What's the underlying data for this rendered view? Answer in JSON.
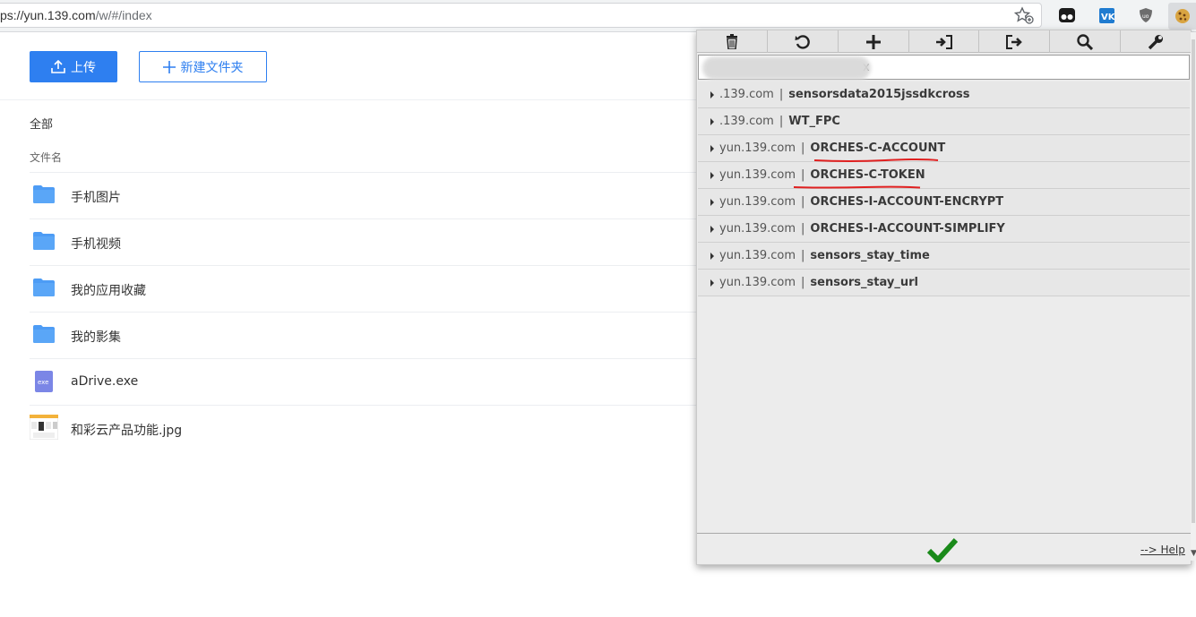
{
  "browser": {
    "url_host": "ps://yun.139.com",
    "url_path": "/w/#/index"
  },
  "toolbar": {
    "upload_label": "上传",
    "new_folder_label": "新建文件夹"
  },
  "breadcrumb": {
    "all": "全部"
  },
  "table": {
    "column_name": "文件名"
  },
  "files": [
    {
      "name": "手机图片",
      "icon": "folder-icon"
    },
    {
      "name": "手机视频",
      "icon": "folder-icon"
    },
    {
      "name": "我的应用收藏",
      "icon": "folder-icon"
    },
    {
      "name": "我的影集",
      "icon": "folder-icon"
    },
    {
      "name": "aDrive.exe",
      "icon": "exe-file-icon",
      "icon_text": "exe"
    },
    {
      "name": "和彩云产品功能.jpg",
      "icon": "image-thumbnail-icon"
    }
  ],
  "cookie_popup": {
    "filter_value": "x",
    "toolbar_icons": [
      "trash-icon",
      "undo-icon",
      "plus-icon",
      "import-icon",
      "export-icon",
      "search-icon",
      "wrench-icon"
    ],
    "cookies": [
      {
        "domain": ".139.com",
        "name": "sensorsdata2015jssdkcross",
        "highlighted": false
      },
      {
        "domain": ".139.com",
        "name": "WT_FPC",
        "highlighted": false
      },
      {
        "domain": "yun.139.com",
        "name": "ORCHES-C-ACCOUNT",
        "highlighted": true
      },
      {
        "domain": "yun.139.com",
        "name": "ORCHES-C-TOKEN",
        "highlighted": true
      },
      {
        "domain": "yun.139.com",
        "name": "ORCHES-I-ACCOUNT-ENCRYPT",
        "highlighted": false
      },
      {
        "domain": "yun.139.com",
        "name": "ORCHES-I-ACCOUNT-SIMPLIFY",
        "highlighted": false
      },
      {
        "domain": "yun.139.com",
        "name": "sensors_stay_time",
        "highlighted": false
      },
      {
        "domain": "yun.139.com",
        "name": "sensors_stay_url",
        "highlighted": false
      }
    ],
    "separator": "|",
    "help_label": "--> Help",
    "accent_check": "#1a8a1a",
    "underline_color": "#e02020"
  },
  "colors": {
    "primary": "#2e7ff0",
    "folder": "#4d9cf5"
  }
}
